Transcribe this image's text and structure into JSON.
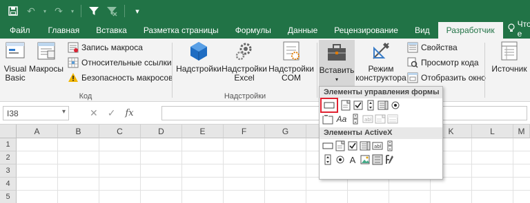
{
  "quick_access": {
    "icons": [
      "save-icon",
      "undo-icon",
      "redo-icon",
      "filter-icon",
      "clear-filter-icon",
      "customize-icon"
    ]
  },
  "tabs": [
    {
      "label": "Файл",
      "active": false
    },
    {
      "label": "Главная",
      "active": false
    },
    {
      "label": "Вставка",
      "active": false
    },
    {
      "label": "Разметка страницы",
      "active": false
    },
    {
      "label": "Формулы",
      "active": false
    },
    {
      "label": "Данные",
      "active": false
    },
    {
      "label": "Рецензирование",
      "active": false
    },
    {
      "label": "Вид",
      "active": false
    },
    {
      "label": "Разработчик",
      "active": true
    }
  ],
  "tell_me": "Что е",
  "ribbon": {
    "code": {
      "label": "Код",
      "visual_basic": "Visual Basic",
      "macros": "Макросы",
      "record_macro": "Запись макроса",
      "relative_refs": "Относительные ссылки",
      "macro_security": "Безопасность макросов"
    },
    "addins": {
      "label": "Надстройки",
      "addins": "Надстройки",
      "excel_addins": "Надстройки Excel",
      "com_addins": "Надстройки COM"
    },
    "controls": {
      "insert": "Вставить",
      "design_mode": "Режим конструктора",
      "properties": "Свойства",
      "view_code": "Просмотр кода",
      "run_dialog": "Отобразить окно"
    },
    "xml": {
      "source": "Источник"
    }
  },
  "formula_bar": {
    "name_box": "I38",
    "formula": ""
  },
  "grid": {
    "columns": [
      "A",
      "B",
      "C",
      "D",
      "E",
      "F",
      "G",
      "H",
      "I",
      "J",
      "K",
      "L",
      "M"
    ],
    "rows": [
      "1",
      "2",
      "3",
      "4",
      "5"
    ]
  },
  "insert_menu": {
    "form_controls_header": "Элементы управления формы",
    "activex_header": "Элементы ActiveX"
  },
  "colors": {
    "accent": "#217346",
    "highlight": "#e0202f"
  }
}
